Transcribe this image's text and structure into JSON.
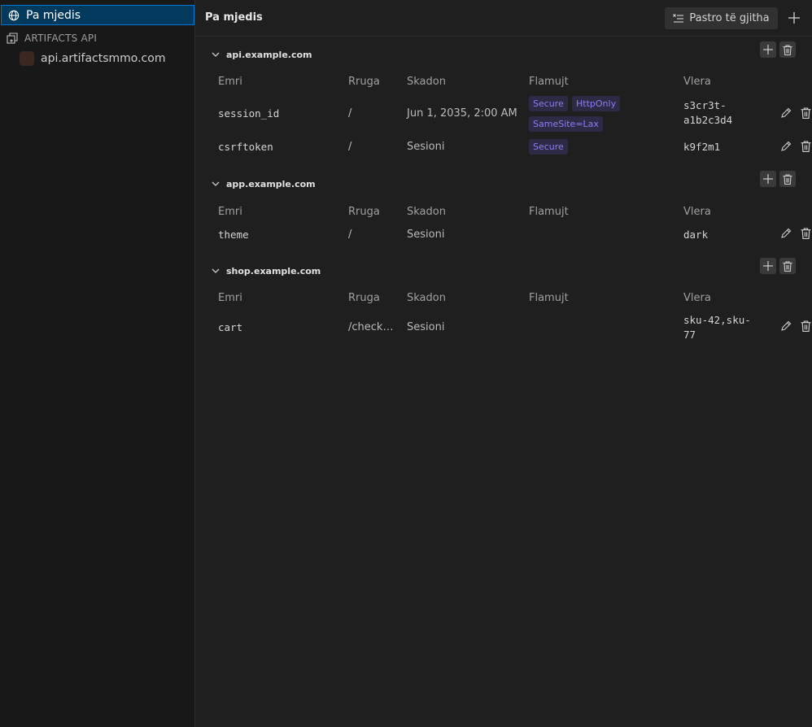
{
  "sidebar": {
    "environment": {
      "label": "Pa mjedis",
      "icon": "globe-icon"
    },
    "group": {
      "label": "ARTIFACTS API",
      "icon": "collection-icon"
    },
    "api_item": {
      "label": "api.artifactsmmo.com"
    }
  },
  "header": {
    "title": "Pa mjedis",
    "clear_label": "Pastro të gjitha",
    "add_icon": "plus-icon"
  },
  "columns": {
    "name": "Emri",
    "path": "Rruga",
    "expires": "Skadon",
    "flags": "Flamujt",
    "value": "Vlera"
  },
  "domains": [
    {
      "name": "api.example.com",
      "rows": [
        {
          "name": "session_id",
          "path": "/",
          "expires": "Jun 1, 2035, 2:00 AM",
          "flags": [
            "Secure",
            "HttpOnly",
            "SameSite=Lax"
          ],
          "value_lines": [
            "s3cr3t-",
            "a1b2c3d4"
          ]
        },
        {
          "name": "csrftoken",
          "path": "/",
          "expires": "Sesioni",
          "flags": [
            "Secure"
          ],
          "value_lines": [
            "k9f2m1"
          ]
        }
      ]
    },
    {
      "name": "app.example.com",
      "rows": [
        {
          "name": "theme",
          "path": "/",
          "expires": "Sesioni",
          "flags": [],
          "value_lines": [
            "dark"
          ]
        }
      ]
    },
    {
      "name": "shop.example.com",
      "rows": [
        {
          "name": "cart",
          "path": "/check…",
          "expires": "Sesioni",
          "flags": [],
          "value_lines": [
            "sku-42,sku-",
            "77"
          ]
        }
      ]
    }
  ],
  "colors": {
    "accent": "#0078d4",
    "selected_bg": "#04395e",
    "flag_text": "#8b7df2",
    "flag_bg": "#2d2a45"
  }
}
